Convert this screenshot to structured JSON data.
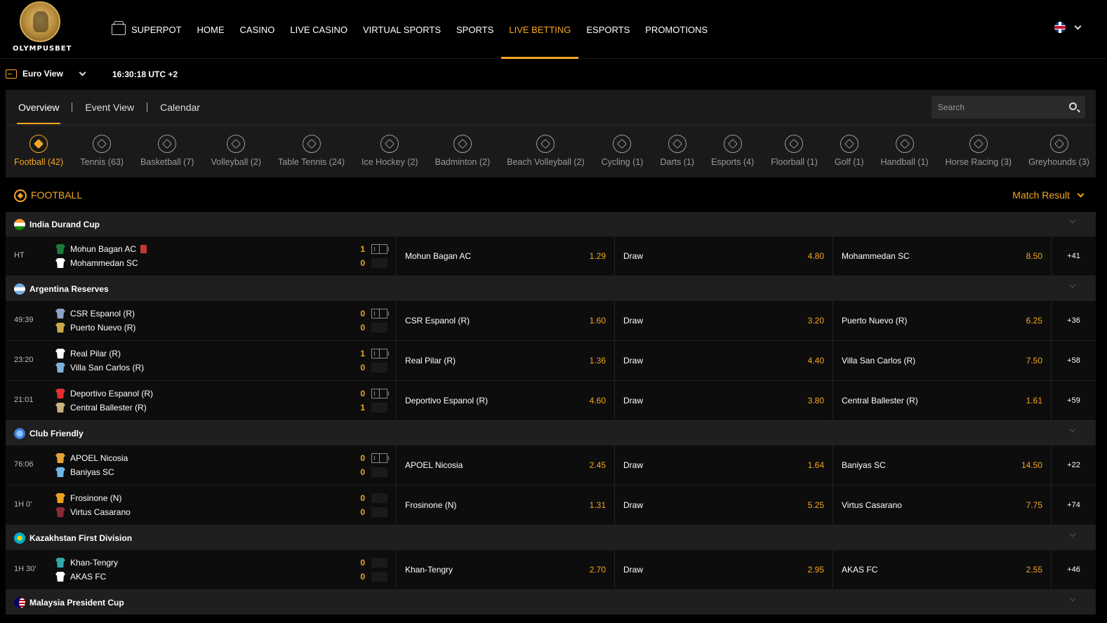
{
  "brand": {
    "name": "OLYMPUSBET"
  },
  "nav": {
    "items": [
      {
        "label": "SUPERPOT"
      },
      {
        "label": "HOME"
      },
      {
        "label": "CASINO"
      },
      {
        "label": "LIVE CASINO"
      },
      {
        "label": "VIRTUAL SPORTS"
      },
      {
        "label": "SPORTS"
      },
      {
        "label": "LIVE BETTING"
      },
      {
        "label": "ESPORTS"
      },
      {
        "label": "PROMOTIONS"
      }
    ],
    "active_label": "LIVE BETTING"
  },
  "view": {
    "label": "Euro View",
    "time": "16:30:18 UTC +2"
  },
  "tabs": [
    {
      "label": "Overview"
    },
    {
      "label": "Event View"
    },
    {
      "label": "Calendar"
    }
  ],
  "search": {
    "placeholder": "Search"
  },
  "sports": [
    {
      "label": "Football (42)",
      "icon": "football-icon"
    },
    {
      "label": "Tennis (63)",
      "icon": "tennis-icon"
    },
    {
      "label": "Basketball (7)",
      "icon": "basketball-icon"
    },
    {
      "label": "Volleyball (2)",
      "icon": "volleyball-icon"
    },
    {
      "label": "Table Tennis (24)",
      "icon": "table-tennis-icon"
    },
    {
      "label": "Ice Hockey (2)",
      "icon": "ice-hockey-icon"
    },
    {
      "label": "Badminton (2)",
      "icon": "badminton-icon"
    },
    {
      "label": "Beach Volleyball (2)",
      "icon": "beach-volleyball-icon"
    },
    {
      "label": "Cycling (1)",
      "icon": "cycling-icon"
    },
    {
      "label": "Darts (1)",
      "icon": "darts-icon"
    },
    {
      "label": "Esports (4)",
      "icon": "esports-icon"
    },
    {
      "label": "Floorball (1)",
      "icon": "floorball-icon"
    },
    {
      "label": "Golf (1)",
      "icon": "golf-icon"
    },
    {
      "label": "Handball (1)",
      "icon": "handball-icon"
    },
    {
      "label": "Horse Racing (3)",
      "icon": "horse-racing-icon"
    },
    {
      "label": "Greyhounds (3)",
      "icon": "greyhounds-icon"
    }
  ],
  "section": {
    "title": "FOOTBALL",
    "market": "Match Result"
  },
  "colors": {
    "accent": "#f5a623",
    "bg": "#000000",
    "panel": "#1a1a1a"
  },
  "leagues": [
    {
      "name": "India Durand Cup",
      "flag": "india-flag",
      "matches": [
        {
          "time": "HT",
          "home": "Mohun Bagan AC",
          "away": "Mohammedan SC",
          "home_score": "1",
          "away_score": "0",
          "home_red_card": true,
          "odds": [
            {
              "name": "Mohun Bagan AC",
              "value": "1.29"
            },
            {
              "name": "Draw",
              "value": "4.80"
            },
            {
              "name": "Mohammedan SC",
              "value": "8.50"
            }
          ],
          "more": "+41"
        }
      ]
    },
    {
      "name": "Argentina Reserves",
      "flag": "argentina-flag",
      "matches": [
        {
          "time": "49:39",
          "home": "CSR Espanol (R)",
          "away": "Puerto Nuevo (R)",
          "home_score": "0",
          "away_score": "0",
          "odds": [
            {
              "name": "CSR Espanol (R)",
              "value": "1.60"
            },
            {
              "name": "Draw",
              "value": "3.20"
            },
            {
              "name": "Puerto Nuevo (R)",
              "value": "6.25"
            }
          ],
          "more": "+36"
        },
        {
          "time": "23:20",
          "home": "Real Pilar (R)",
          "away": "Villa San Carlos (R)",
          "home_score": "1",
          "away_score": "0",
          "odds": [
            {
              "name": "Real Pilar (R)",
              "value": "1.36"
            },
            {
              "name": "Draw",
              "value": "4.40"
            },
            {
              "name": "Villa San Carlos (R)",
              "value": "7.50"
            }
          ],
          "more": "+58"
        },
        {
          "time": "21:01",
          "home": "Deportivo Espanol (R)",
          "away": "Central Ballester (R)",
          "home_score": "0",
          "away_score": "1",
          "odds": [
            {
              "name": "Deportivo Espanol (R)",
              "value": "4.60"
            },
            {
              "name": "Draw",
              "value": "3.80"
            },
            {
              "name": "Central Ballester (R)",
              "value": "1.61"
            }
          ],
          "more": "+59"
        }
      ]
    },
    {
      "name": "Club Friendly",
      "flag": "world-flag",
      "matches": [
        {
          "time": "76:06",
          "home": "APOEL Nicosia",
          "away": "Baniyas SC",
          "home_score": "0",
          "away_score": "0",
          "odds": [
            {
              "name": "APOEL Nicosia",
              "value": "2.45"
            },
            {
              "name": "Draw",
              "value": "1.64"
            },
            {
              "name": "Baniyas SC",
              "value": "14.50"
            }
          ],
          "more": "+22"
        },
        {
          "time": "1H 0'",
          "home": "Frosinone (N)",
          "away": "Virtus Casarano",
          "home_score": "0",
          "away_score": "0",
          "odds": [
            {
              "name": "Frosinone (N)",
              "value": "1.31"
            },
            {
              "name": "Draw",
              "value": "5.25"
            },
            {
              "name": "Virtus Casarano",
              "value": "7.75"
            }
          ],
          "more": "+74"
        }
      ]
    },
    {
      "name": "Kazakhstan First Division",
      "flag": "kazakhstan-flag",
      "matches": [
        {
          "time": "1H 30'",
          "home": "Khan-Tengry",
          "away": "AKAS FC",
          "home_score": "0",
          "away_score": "0",
          "odds": [
            {
              "name": "Khan-Tengry",
              "value": "2.70"
            },
            {
              "name": "Draw",
              "value": "2.95"
            },
            {
              "name": "AKAS FC",
              "value": "2.55"
            }
          ],
          "more": "+46"
        }
      ]
    },
    {
      "name": "Malaysia President Cup",
      "flag": "malaysia-flag",
      "matches": []
    }
  ]
}
